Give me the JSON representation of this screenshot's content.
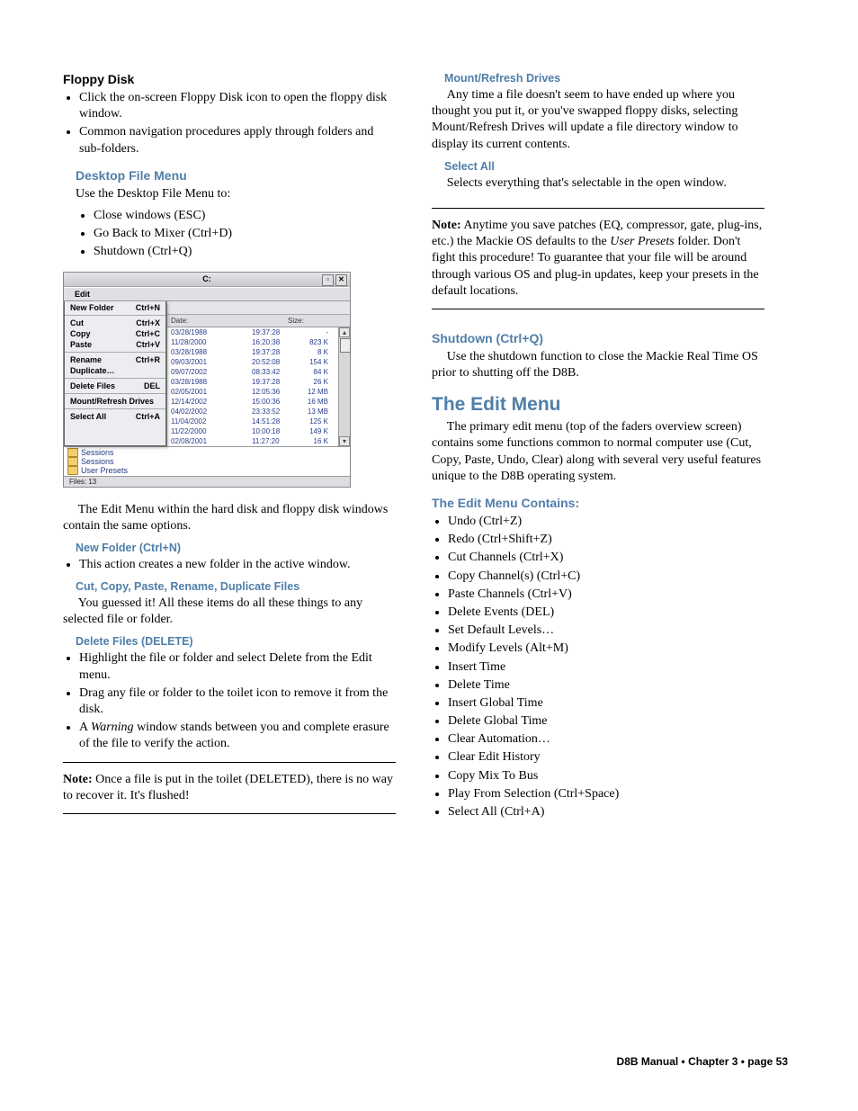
{
  "left": {
    "floppyHeading": "Floppy Disk",
    "floppyBullets": [
      "Click the on-screen Floppy Disk icon to open the floppy disk window.",
      "Common navigation procedures apply through folders and sub-folders."
    ],
    "desktopFileMenu": "Desktop File Menu",
    "desktopIntro": "Use the Desktop File Menu to:",
    "desktopBullets": [
      "Close windows (ESC)",
      "Go Back to Mixer (Ctrl+D)",
      "Shutdown (Ctrl+Q)"
    ],
    "paraEditMenu": "The Edit Menu within the hard disk and floppy disk windows contain the same options.",
    "newFolderH": "New Folder (Ctrl+N)",
    "newFolderBullet": "This action creates a new folder in the active window.",
    "cutCopyH": "Cut, Copy, Paste, Rename, Duplicate Files",
    "cutCopyP": "You guessed it! All these items do all these things to any selected file or folder.",
    "deleteH": "Delete Files (DELETE)",
    "deleteBullets": [
      "Highlight the file or folder and select Delete from the Edit menu.",
      "Drag any file or folder to the toilet icon to remove it from the disk."
    ],
    "deleteWarn1": "A ",
    "deleteWarnEm": "Warning",
    "deleteWarn2": " window stands between you and complete erasure of the file to verify the action.",
    "note1b": "Note:",
    "note1": " Once a file is put in the toilet (DELETED), there is no way to recover it. It's flushed!"
  },
  "right": {
    "mountH": "Mount/Refresh Drives",
    "mountP": "Any time a file doesn't seem to have ended up where you thought you put it, or you've swapped floppy disks, selecting Mount/Refresh Drives will update a file directory window to display its current contents.",
    "selectAllH": "Select All",
    "selectAllP": "Selects everything that's selectable in the open window.",
    "note2b": "Note:",
    "note2a": " Anytime you save patches (EQ, compressor, gate, plug-ins, etc.) the Mackie OS defaults to the ",
    "note2em": "User Presets",
    "note2c": " folder. Don't fight this procedure! To guarantee that your file will be around through various OS and plug-in updates, keep your presets in the default locations.",
    "shutdownH": "Shutdown (Ctrl+Q)",
    "shutdownP": "Use the shutdown function to close the Mackie Real Time OS prior to shutting off the D8B.",
    "editMenuH": "The Edit Menu",
    "editMenuP": "The primary edit menu (top of the faders overview screen) contains some functions common to normal computer use (Cut, Copy, Paste, Undo, Clear) along with several very useful features unique to the D8B operating system.",
    "containsH": "The Edit Menu Contains:",
    "containsList": [
      "Undo (Ctrl+Z)",
      "Redo (Ctrl+Shift+Z)",
      "Cut Channels (Ctrl+X)",
      "Copy Channel(s) (Ctrl+C)",
      "Paste Channels (Ctrl+V)",
      "Delete Events (DEL)",
      "Set Default Levels…",
      "Modify Levels (Alt+M)",
      "Insert Time",
      "Delete Time",
      "Insert Global Time",
      "Delete Global Time",
      "Clear Automation…",
      "Clear Edit History",
      "Copy Mix To Bus",
      "Play From Selection (Ctrl+Space)",
      "Select All (Ctrl+A)"
    ]
  },
  "win": {
    "title": "C:",
    "menubarEdit": "Edit",
    "menu": [
      {
        "label": "New Folder",
        "sc": "Ctrl+N",
        "sep": true
      },
      {
        "label": "Cut",
        "sc": "Ctrl+X"
      },
      {
        "label": "Copy",
        "sc": "Ctrl+C"
      },
      {
        "label": "Paste",
        "sc": "Ctrl+V",
        "sep": true
      },
      {
        "label": "Rename",
        "sc": "Ctrl+R"
      },
      {
        "label": "Duplicate…",
        "sc": "",
        "sep": true
      },
      {
        "label": "Delete Files",
        "sc": "DEL",
        "sep": true
      },
      {
        "label": "Mount/Refresh Drives",
        "sc": "",
        "sep": true
      },
      {
        "label": "Select All",
        "sc": "Ctrl+A"
      }
    ],
    "dateH": "Date:",
    "sizeH": "Size:",
    "rows": [
      {
        "date": "03/28/1988",
        "time": "19:37:28",
        "size": "-"
      },
      {
        "date": "11/28/2000",
        "time": "16:20:38",
        "size": "823 K"
      },
      {
        "date": "03/28/1988",
        "time": "19:37:28",
        "size": "8 K"
      },
      {
        "date": "09/03/2001",
        "time": "20:52:08",
        "size": "154 K"
      },
      {
        "date": "09/07/2002",
        "time": "08:33:42",
        "size": "84 K"
      },
      {
        "date": "03/28/1988",
        "time": "19:37:28",
        "size": "26 K"
      },
      {
        "date": "02/05/2001",
        "time": "12:05:36",
        "size": "12 MB"
      },
      {
        "date": "12/14/2002",
        "time": "15:00:36",
        "size": "16 MB"
      },
      {
        "date": "04/02/2002",
        "time": "23:33:52",
        "size": "13 MB"
      },
      {
        "date": "11/04/2002",
        "time": "14:51:28",
        "size": "125 K"
      },
      {
        "date": "11/22/2000",
        "time": "10:00:18",
        "size": "149 K"
      },
      {
        "date": "02/08/2001",
        "time": "11:27:20",
        "size": "16 K"
      }
    ],
    "tree": [
      "Sessions",
      "Sessions",
      "User Presets"
    ],
    "status": "Files:   13"
  },
  "footer": "D8B Manual • Chapter 3 • page  53"
}
